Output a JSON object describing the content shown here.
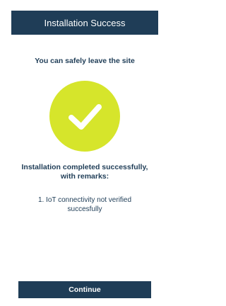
{
  "header": {
    "title": "Installation Success"
  },
  "message": {
    "subtitle": "You can safely leave the site",
    "result_title": "Installation completed successfully, with remarks:",
    "remarks": [
      "1. IoT connectivity not verified succesfully"
    ]
  },
  "status": {
    "icon": "checkmark-icon",
    "circle_color": "#d6e52b",
    "check_color": "#ffffff"
  },
  "actions": {
    "continue_label": "Continue"
  },
  "theme": {
    "primary": "#1f3d57",
    "background": "#ffffff"
  }
}
